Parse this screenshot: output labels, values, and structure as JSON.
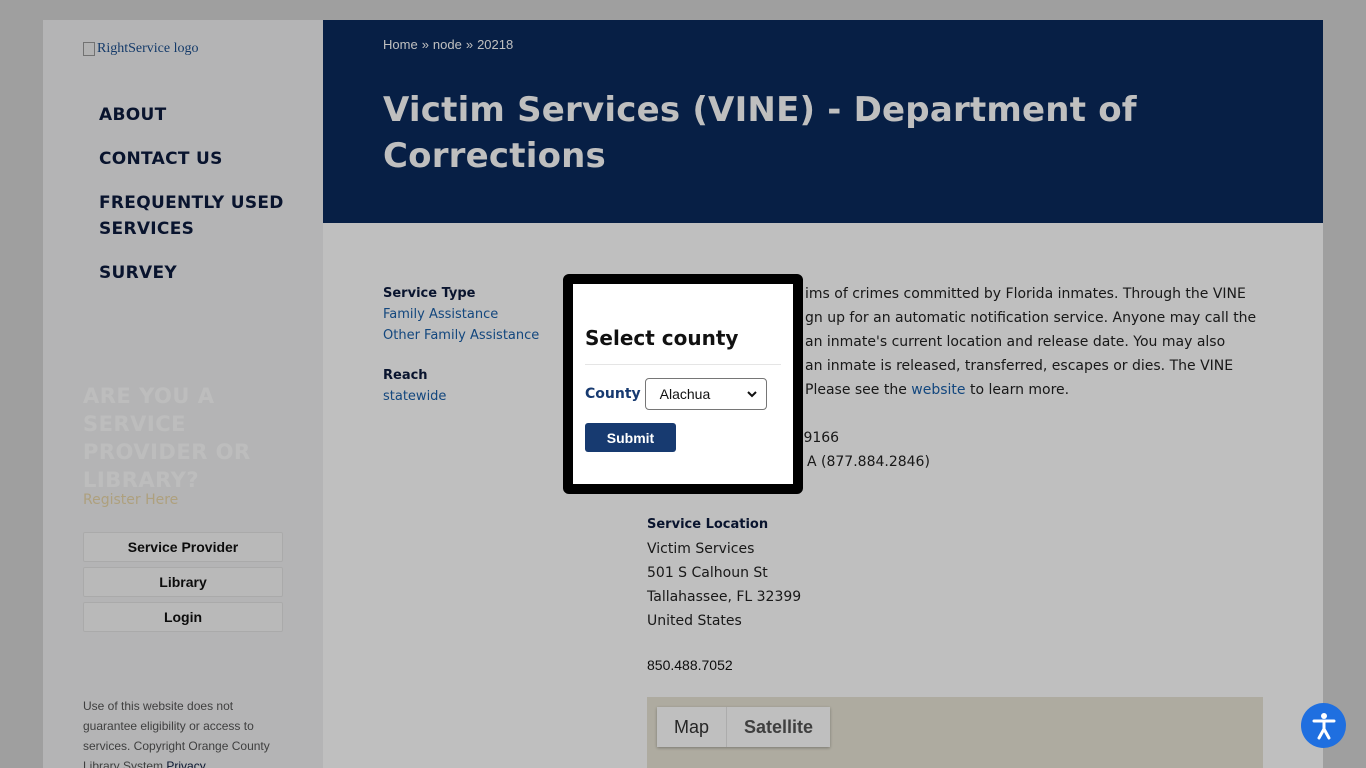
{
  "sidebar": {
    "logo_alt": "RightService logo",
    "nav": [
      "ABOUT",
      "CONTACT US",
      "FREQUENTLY USED SERVICES",
      "SURVEY"
    ],
    "promo_title": "ARE YOU A SERVICE PROVIDER OR LIBRARY?",
    "promo_sub": "Register Here",
    "buttons": [
      "Service Provider",
      "Library",
      "Login"
    ],
    "disclaimer": "Use of this website does not guarantee eligibility or access to services. Copyright Orange County Library System",
    "privacy_link": "Privacy"
  },
  "header": {
    "breadcrumb": [
      "Home",
      "node",
      "20218"
    ],
    "breadcrumb_sep": "»",
    "title": "Victim Services (VINE) - Department of Corrections"
  },
  "content": {
    "service_type_label": "Service Type",
    "service_types": [
      "Family Assistance",
      "Other Family Assistance"
    ],
    "reach_label": "Reach",
    "reach_value": "statewide",
    "desc_lines": [
      "ims of crimes committed by Florida inmates. Through the VINE",
      "gn up for an automatic notification service. Anyone may call the",
      "an inmate's current location and release date. You may also",
      "an inmate is released, transferred, escapes or dies. The VINE",
      "Please see the"
    ],
    "desc_link": "website",
    "desc_tail": "to learn more.",
    "phones": [
      ".9166",
      "A (877.884.2846)"
    ],
    "location_label": "Service Location",
    "location_lines": [
      "Victim Services",
      "501 S Calhoun St",
      "Tallahassee, FL 32399",
      "United States"
    ],
    "location_phone": "850.488.7052",
    "map_buttons": [
      "Map",
      "Satellite"
    ]
  },
  "modal": {
    "title": "Select county",
    "county_label": "County",
    "county_selected": "Alachua",
    "submit_label": "Submit"
  },
  "colors": {
    "header_bg": "#0a2a5c",
    "accent": "#173a70",
    "link": "#1a5fa8",
    "a11y_button": "#1f6fe0"
  }
}
